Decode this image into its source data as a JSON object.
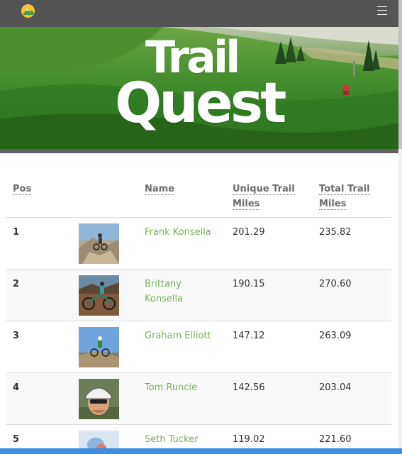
{
  "navbar": {
    "logo_icon": "trailquest-logo-icon",
    "menu_icon": "hamburger-menu-icon",
    "background": "#545454"
  },
  "hero": {
    "brand_line1": "Trail",
    "brand_line2": "Quest",
    "scene": "green alpine meadow with mountain biker"
  },
  "leaderboard": {
    "headers": {
      "pos": "Pos",
      "name": "Name",
      "unique": "Unique Trail Miles",
      "total": "Total Trail Miles"
    },
    "rows": [
      {
        "pos": "1",
        "name": "Frank Konsella",
        "unique": "201.29",
        "total": "235.82",
        "photo_icon": "rider-photo-rocky-descent"
      },
      {
        "pos": "2",
        "name": "Brittany Konsella",
        "unique": "190.15",
        "total": "270.60",
        "photo_icon": "rider-photo-desert-bike"
      },
      {
        "pos": "3",
        "name": "Graham Elliott",
        "unique": "147.12",
        "total": "263.09",
        "photo_icon": "rider-photo-blue-sky"
      },
      {
        "pos": "4",
        "name": "Tom Runcie",
        "unique": "142.56",
        "total": "203.04",
        "photo_icon": "rider-photo-helmet-selfie"
      },
      {
        "pos": "5",
        "name": "Seth Tucker",
        "unique": "119.02",
        "total": "221.60",
        "photo_icon": "rider-photo-blurred"
      }
    ]
  },
  "colors": {
    "accent_link": "#78b05a",
    "navbar": "#545454",
    "bottom_bar": "#3d8ede"
  }
}
